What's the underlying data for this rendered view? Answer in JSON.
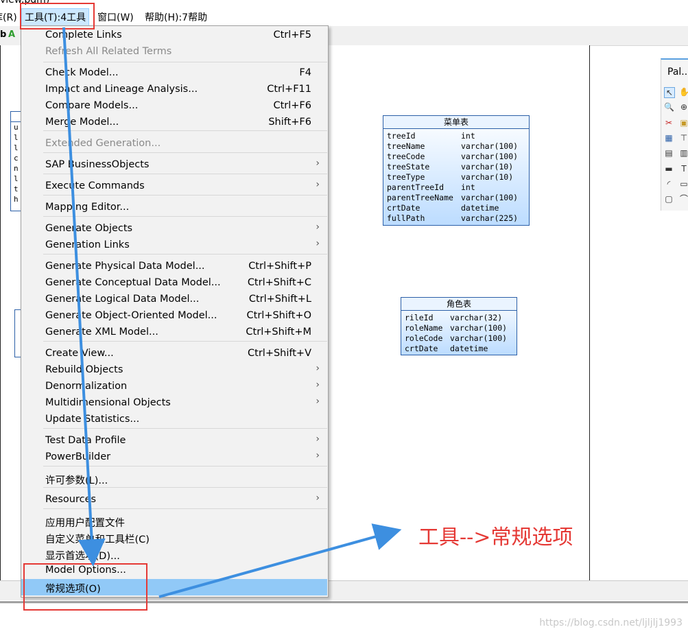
{
  "window": {
    "title_fragment": "view.pdm)"
  },
  "menubar": {
    "items": [
      "库(R)",
      "工具(T):4工具",
      "窗口(W)",
      "帮助(H):7帮助"
    ],
    "active_index": 1
  },
  "toolbar": {
    "icon_glyphs": [
      "b",
      "A"
    ]
  },
  "menu": {
    "items": [
      {
        "label": "Complete Links",
        "shortcut": "Ctrl+F5",
        "disabled": false,
        "submenu": false
      },
      {
        "label": "Refresh All Related Terms",
        "shortcut": "",
        "disabled": true,
        "submenu": false
      },
      {
        "label": "Check Model...",
        "shortcut": "F4",
        "disabled": false,
        "submenu": false
      },
      {
        "label": "Impact and Lineage Analysis...",
        "shortcut": "Ctrl+F11",
        "disabled": false,
        "submenu": false
      },
      {
        "label": "Compare Models...",
        "shortcut": "Ctrl+F6",
        "disabled": false,
        "submenu": false
      },
      {
        "label": "Merge Model...",
        "shortcut": "Shift+F6",
        "disabled": false,
        "submenu": false
      },
      {
        "label": "Extended Generation...",
        "shortcut": "",
        "disabled": true,
        "submenu": false
      },
      {
        "label": "SAP BusinessObjects",
        "shortcut": "",
        "disabled": false,
        "submenu": true
      },
      {
        "label": "Execute Commands",
        "shortcut": "",
        "disabled": false,
        "submenu": true
      },
      {
        "label": "Mapping Editor...",
        "shortcut": "",
        "disabled": false,
        "submenu": false
      },
      {
        "label": "Generate Objects",
        "shortcut": "",
        "disabled": false,
        "submenu": true
      },
      {
        "label": "Generation Links",
        "shortcut": "",
        "disabled": false,
        "submenu": true
      },
      {
        "label": "Generate Physical Data Model...",
        "shortcut": "Ctrl+Shift+P",
        "disabled": false,
        "submenu": false
      },
      {
        "label": "Generate Conceptual Data Model...",
        "shortcut": "Ctrl+Shift+C",
        "disabled": false,
        "submenu": false
      },
      {
        "label": "Generate Logical Data Model...",
        "shortcut": "Ctrl+Shift+L",
        "disabled": false,
        "submenu": false
      },
      {
        "label": "Generate Object-Oriented Model...",
        "shortcut": "Ctrl+Shift+O",
        "disabled": false,
        "submenu": false
      },
      {
        "label": "Generate XML Model...",
        "shortcut": "Ctrl+Shift+M",
        "disabled": false,
        "submenu": false
      },
      {
        "label": "Create View...",
        "shortcut": "Ctrl+Shift+V",
        "disabled": false,
        "submenu": false
      },
      {
        "label": "Rebuild Objects",
        "shortcut": "",
        "disabled": false,
        "submenu": true
      },
      {
        "label": "Denormalization",
        "shortcut": "",
        "disabled": false,
        "submenu": true
      },
      {
        "label": "Multidimensional Objects",
        "shortcut": "",
        "disabled": false,
        "submenu": true
      },
      {
        "label": "Update Statistics...",
        "shortcut": "",
        "disabled": false,
        "submenu": false
      },
      {
        "label": "Test Data Profile",
        "shortcut": "",
        "disabled": false,
        "submenu": true
      },
      {
        "label": "PowerBuilder",
        "shortcut": "",
        "disabled": false,
        "submenu": true
      },
      {
        "label": "许可参数(L)...",
        "shortcut": "",
        "disabled": false,
        "submenu": false
      },
      {
        "label": "Resources",
        "shortcut": "",
        "disabled": false,
        "submenu": true
      },
      {
        "label": "应用用户配置文件",
        "shortcut": "",
        "disabled": false,
        "submenu": false
      },
      {
        "label": "自定义菜单和工具栏(C)",
        "shortcut": "",
        "disabled": false,
        "submenu": false
      },
      {
        "label": "显示首选项(D)...",
        "shortcut": "",
        "disabled": false,
        "submenu": false
      },
      {
        "label": "Model Options...",
        "shortcut": "",
        "disabled": false,
        "submenu": false
      },
      {
        "label": "常规选项(O)",
        "shortcut": "",
        "disabled": false,
        "submenu": false,
        "highlighted": true
      }
    ]
  },
  "entities": [
    {
      "title": "菜单表",
      "columns": [
        {
          "name": "treeId",
          "type": "int"
        },
        {
          "name": "treeName",
          "type": "varchar(100)"
        },
        {
          "name": "treeCode",
          "type": "varchar(100)"
        },
        {
          "name": "treeState",
          "type": "varchar(10)"
        },
        {
          "name": "treeType",
          "type": "varchar(10)"
        },
        {
          "name": "parentTreeId",
          "type": "int"
        },
        {
          "name": "parentTreeName",
          "type": "varchar(100)"
        },
        {
          "name": "crtDate",
          "type": "datetime"
        },
        {
          "name": "fullPath",
          "type": "varchar(225)"
        }
      ]
    },
    {
      "title": "角色表",
      "columns": [
        {
          "name": "rileId",
          "type": "varchar(32)"
        },
        {
          "name": "roleName",
          "type": "varchar(100)"
        },
        {
          "name": "roleCode",
          "type": "varchar(100)"
        },
        {
          "name": "crtDate",
          "type": "datetime"
        }
      ]
    }
  ],
  "left_stub_letters": [
    "u",
    "l",
    "l",
    "c",
    "n",
    "l",
    "t",
    "h"
  ],
  "palette": {
    "title": "Pal..."
  },
  "annotation": {
    "text": "工具-->常规选项",
    "color": "#e53935"
  },
  "watermark": "https://blog.csdn.net/ljljlj1993",
  "colors": {
    "highlight": "#91c9f7",
    "arrow": "#3d8fe0",
    "entity_border": "#2b5fa7"
  }
}
